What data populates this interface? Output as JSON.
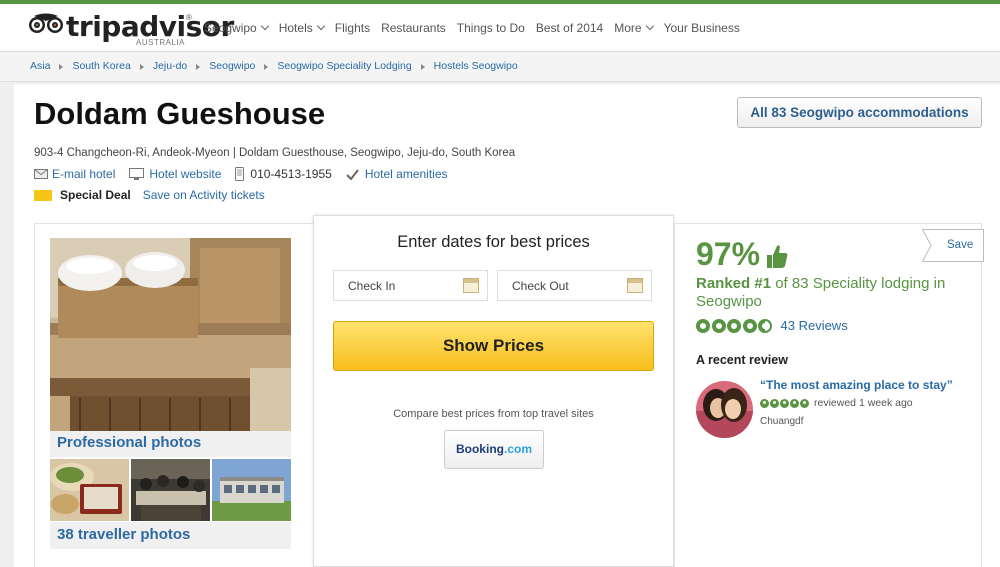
{
  "brand": {
    "name": "tripadvisor",
    "registered": "®",
    "region": "AUSTRALIA",
    "accent_color": "#589442"
  },
  "nav": {
    "items": [
      {
        "label": "Seogwipo",
        "dropdown": true
      },
      {
        "label": "Hotels",
        "dropdown": true
      },
      {
        "label": "Flights",
        "dropdown": false
      },
      {
        "label": "Restaurants",
        "dropdown": false
      },
      {
        "label": "Things to Do",
        "dropdown": false
      },
      {
        "label": "Best of 2014",
        "dropdown": false
      },
      {
        "label": "More",
        "dropdown": true
      },
      {
        "label": "Your Business",
        "dropdown": false
      }
    ]
  },
  "breadcrumb": [
    "Asia",
    "South Korea",
    "Jeju-do",
    "Seogwipo",
    "Seogwipo Speciality Lodging",
    "Hostels Seogwipo"
  ],
  "hotel": {
    "name": "Doldam Gueshouse",
    "address": "903-4 Changcheon-Ri, Andeok-Myeon | Doldam Guesthouse, Seogwipo, Jeju-do, South Korea",
    "email_label": "E-mail hotel",
    "website_label": "Hotel website",
    "phone": "010-4513-1955",
    "amenities_label": "Hotel amenities",
    "special_deal_label": "Special Deal",
    "special_deal_link": "Save on Activity tickets",
    "all_accommodations_label": "All 83 Seogwipo accommodations"
  },
  "photos": {
    "professional_label": "Professional photos",
    "traveller_label": "38 traveller photos"
  },
  "booking": {
    "title": "Enter dates for best prices",
    "check_in_placeholder": "Check In",
    "check_out_placeholder": "Check Out",
    "show_prices_label": "Show Prices",
    "compare_text": "Compare best prices from top travel sites",
    "partner_name": "Booking",
    "partner_suffix": ".com"
  },
  "rating": {
    "save_label": "Save",
    "percent": "97%",
    "ranked_prefix": "Ranked #1",
    "ranked_suffix": " of 83 Speciality lodging in Seogwipo",
    "bubbles": 4.5,
    "reviews_label": "43 Reviews"
  },
  "recent_review": {
    "heading": "A recent review",
    "quote": "“The most amazing place to stay”",
    "bubbles": 5,
    "when": "reviewed 1 week ago",
    "reviewer": "Chuangdf"
  }
}
